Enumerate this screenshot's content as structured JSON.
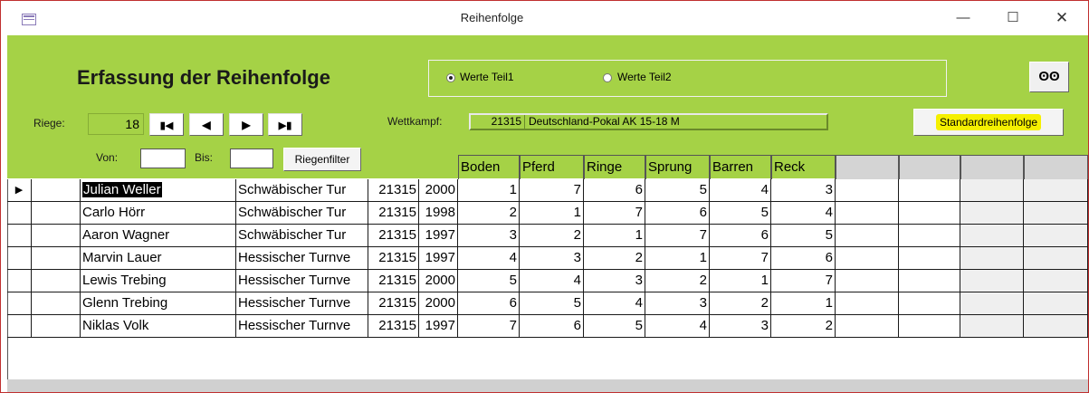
{
  "window": {
    "title": "Reihenfolge",
    "minimize": "—",
    "maximize": "☐",
    "close": "✕"
  },
  "header": {
    "form_title": "Erfassung der Reihenfolge",
    "options": [
      {
        "label": "Werte Teil1",
        "checked": true
      },
      {
        "label": "Werte Teil2",
        "checked": false
      }
    ],
    "search_icon": "binoculars-icon",
    "riege_label": "Riege:",
    "riege_value": "18",
    "nav": {
      "first": "▮◀",
      "prev": "◀",
      "next": "▶",
      "last": "▶▮"
    },
    "wettkampf_label": "Wettkampf:",
    "wettkampf_number": "21315",
    "wettkampf_name": "Deutschland-Pokal AK 15-18 M",
    "std_button": "Standardreihenfolge",
    "von_label": "Von:",
    "bis_label": "Bis:",
    "von_value": "",
    "bis_value": "",
    "filter_button": "Riegenfilter"
  },
  "columns": [
    "Boden",
    "Pferd",
    "Ringe",
    "Sprung",
    "Barren",
    "Reck"
  ],
  "rows": [
    {
      "name": "Julian Weller",
      "club": "Schwäbischer Tur",
      "comp": "21315",
      "year": "2000",
      "values": [
        "1",
        "7",
        "6",
        "5",
        "4",
        "3"
      ]
    },
    {
      "name": "Carlo Hörr",
      "club": "Schwäbischer Tur",
      "comp": "21315",
      "year": "1998",
      "values": [
        "2",
        "1",
        "7",
        "6",
        "5",
        "4"
      ]
    },
    {
      "name": "Aaron Wagner",
      "club": "Schwäbischer Tur",
      "comp": "21315",
      "year": "1997",
      "values": [
        "3",
        "2",
        "1",
        "7",
        "6",
        "5"
      ]
    },
    {
      "name": "Marvin Lauer",
      "club": "Hessischer Turnve",
      "comp": "21315",
      "year": "1997",
      "values": [
        "4",
        "3",
        "2",
        "1",
        "7",
        "6"
      ]
    },
    {
      "name": "Lewis Trebing",
      "club": "Hessischer Turnve",
      "comp": "21315",
      "year": "2000",
      "values": [
        "5",
        "4",
        "3",
        "2",
        "1",
        "7"
      ]
    },
    {
      "name": "Glenn Trebing",
      "club": "Hessischer Turnve",
      "comp": "21315",
      "year": "2000",
      "values": [
        "6",
        "5",
        "4",
        "3",
        "2",
        "1"
      ]
    },
    {
      "name": "Niklas Volk",
      "club": "Hessischer Turnve",
      "comp": "21315",
      "year": "1997",
      "values": [
        "7",
        "6",
        "5",
        "4",
        "3",
        "2"
      ]
    }
  ],
  "record_selector": "▶",
  "colors": {
    "header_green": "#a5d246",
    "highlight": "#f5f000"
  }
}
